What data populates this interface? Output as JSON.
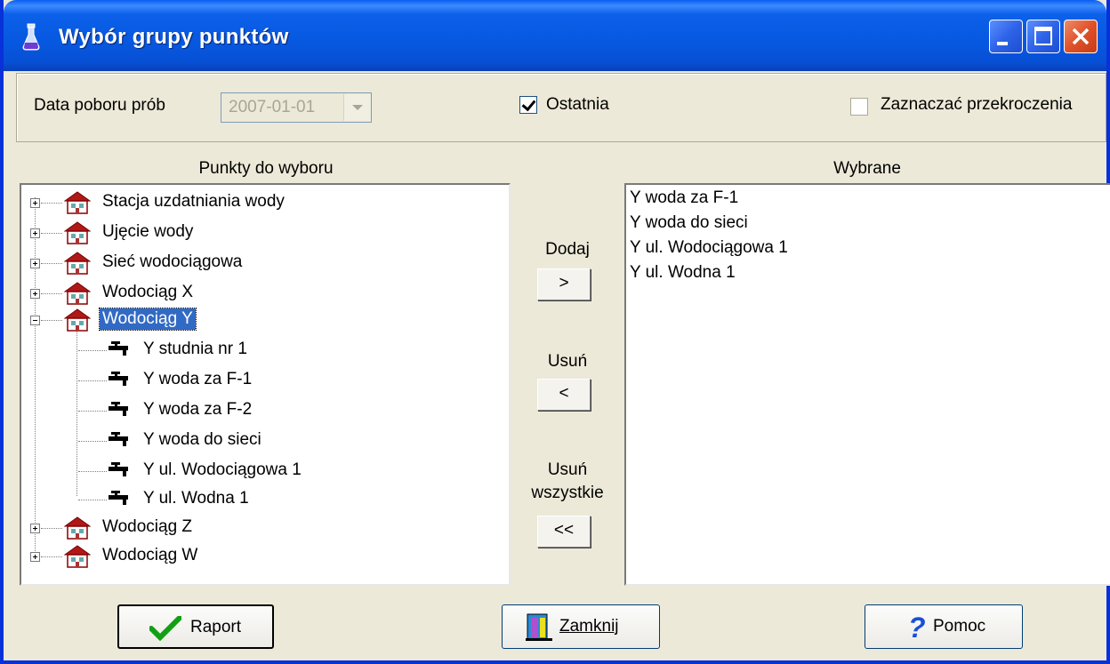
{
  "window": {
    "title": "Wybór grupy punktów"
  },
  "top": {
    "date_label": "Data poboru prób",
    "date_value": "2007-01-01",
    "ostatnia_label": "Ostatnia",
    "ostatnia_checked": true,
    "zaznaczac_label": "Zaznaczać przekroczenia",
    "zaznaczac_checked": false
  },
  "tree": {
    "header": "Punkty do wyboru",
    "nodes": [
      {
        "label": "Stacja uzdatniania wody",
        "expanded": false
      },
      {
        "label": "Ujęcie wody",
        "expanded": false
      },
      {
        "label": "Sieć wodociągowa",
        "expanded": false
      },
      {
        "label": "Wodociąg X",
        "expanded": false
      },
      {
        "label": "Wodociąg Y",
        "expanded": true,
        "selected": true,
        "children": [
          "Y studnia nr 1",
          "Y woda za F-1",
          "Y woda za F-2",
          "Y woda do sieci",
          "Y ul. Wodociągowa 1",
          "Y ul. Wodna 1"
        ]
      },
      {
        "label": "Wodociąg Z",
        "expanded": false
      },
      {
        "label": "Wodociąg W",
        "expanded": false
      }
    ]
  },
  "middle": {
    "add_label": "Dodaj",
    "add_btn": ">",
    "remove_label": "Usuń",
    "remove_btn": "<",
    "remove_all_label_1": "Usuń",
    "remove_all_label_2": "wszystkie",
    "remove_all_btn": "<<"
  },
  "selected": {
    "header": "Wybrane",
    "items": [
      "Y woda za F-1",
      "Y woda do sieci",
      "Y ul. Wodociągowa 1",
      "Y ul. Wodna 1"
    ]
  },
  "buttons": {
    "raport": "Raport",
    "zamknij": "Zamknij",
    "pomoc": "Pomoc"
  }
}
